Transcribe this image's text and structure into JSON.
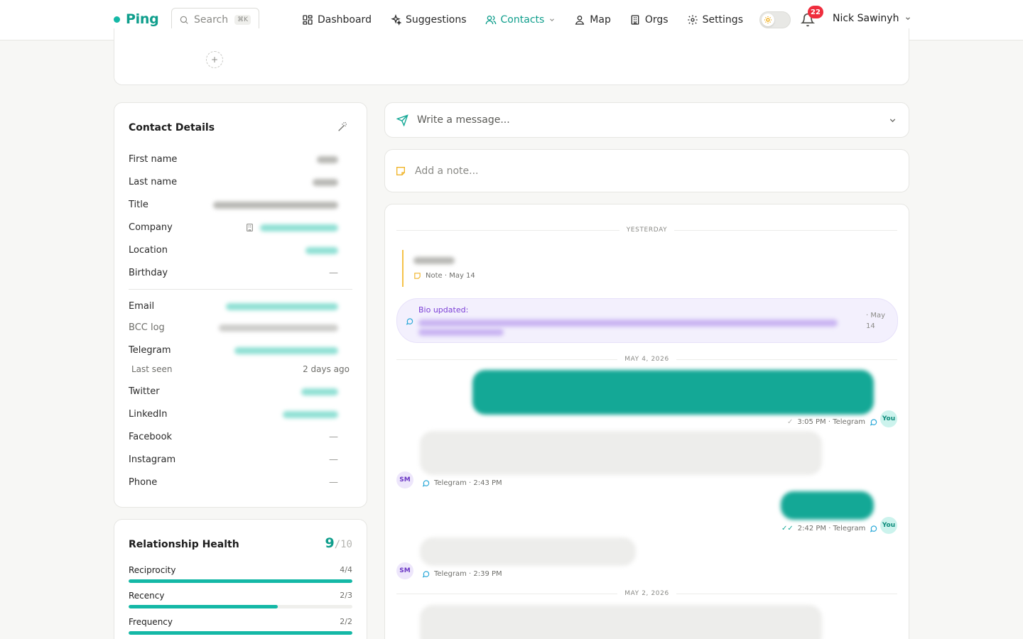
{
  "brand": {
    "name": "Ping",
    "accent": "#0f9e8c"
  },
  "search": {
    "placeholder": "Search",
    "shortcut": "⌘K"
  },
  "nav": {
    "dashboard": "Dashboard",
    "suggestions": "Suggestions",
    "contacts": "Contacts",
    "map": "Map",
    "orgs": "Orgs",
    "settings": "Settings",
    "active": "Contacts"
  },
  "notifications": {
    "count": "22"
  },
  "user": {
    "name": "Nick Sawinyh"
  },
  "contact_details": {
    "title": "Contact Details",
    "fields": {
      "first_name": "First name",
      "last_name": "Last name",
      "title": "Title",
      "company": "Company",
      "location": "Location",
      "birthday": "Birthday",
      "birthday_value": "—",
      "email": "Email",
      "bcc_log": "BCC log",
      "telegram": "Telegram",
      "last_seen": "Last seen",
      "last_seen_value": "2 days ago",
      "twitter": "Twitter",
      "linkedin": "LinkedIn",
      "facebook": "Facebook",
      "facebook_value": "—",
      "instagram": "Instagram",
      "instagram_value": "—",
      "phone": "Phone",
      "phone_value": "—"
    }
  },
  "relationship_health": {
    "title": "Relationship Health",
    "score": "9",
    "score_max": "/10",
    "metrics": [
      {
        "label": "Reciprocity",
        "value": "4/4",
        "fraction": 1.0
      },
      {
        "label": "Recency",
        "value": "2/3",
        "fraction": 0.667
      },
      {
        "label": "Frequency",
        "value": "2/2",
        "fraction": 1.0
      }
    ]
  },
  "composer": {
    "placeholder": "Write a message..."
  },
  "note_composer": {
    "placeholder": "Add a note..."
  },
  "feed": {
    "separators": [
      "YESTERDAY",
      "MAY 4, 2026",
      "MAY 2, 2026"
    ],
    "note_meta": "Note · May 14",
    "bio_label": "Bio updated:",
    "bio_date": "· May 14",
    "messages": [
      {
        "direction": "out",
        "meta": "3:05 PM · Telegram",
        "avatar": "You"
      },
      {
        "direction": "in",
        "meta": "Telegram · 2:43 PM",
        "avatar": "SM"
      },
      {
        "direction": "out",
        "meta": "2:42 PM · Telegram",
        "avatar": "You"
      },
      {
        "direction": "in",
        "meta": "Telegram · 2:39 PM",
        "avatar": "SM"
      }
    ]
  }
}
